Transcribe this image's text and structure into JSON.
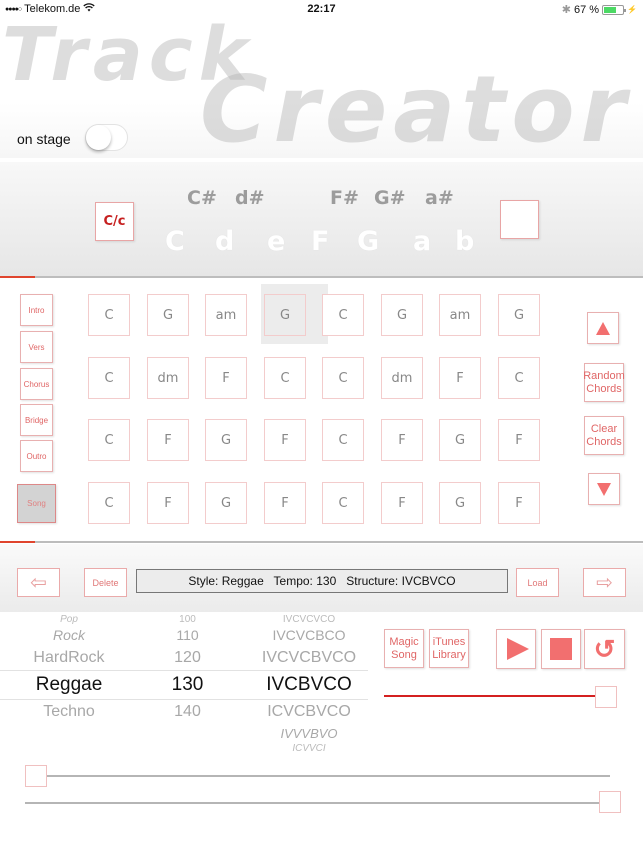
{
  "status_bar": {
    "signal": "●●●●○",
    "carrier": "Telekom.de",
    "wifi_icon": "wifi-icon",
    "time": "22:17",
    "bluetooth_icon": "bluetooth-icon",
    "battery_percent": "67 %",
    "battery_level": 0.67,
    "charging_icon": "⚡"
  },
  "header": {
    "logo_line1": "Track",
    "logo_line2": "Creator",
    "on_stage_label": "on stage",
    "on_stage_enabled": false
  },
  "key_selector": {
    "mode_button": "C/c",
    "sharp_keys": [
      "C#",
      "d#",
      "F#",
      "G#",
      "a#"
    ],
    "natural_keys": [
      "C",
      "d",
      "e",
      "F",
      "G",
      "a",
      "b"
    ],
    "progress": 0.055
  },
  "parts": [
    "Intro",
    "Vers",
    "Chorus",
    "Bridge",
    "Outro"
  ],
  "song_button": "Song",
  "chord_rows": [
    [
      "C",
      "G",
      "am",
      "G",
      "C",
      "G",
      "am",
      "G"
    ],
    [
      "C",
      "dm",
      "F",
      "C",
      "C",
      "dm",
      "F",
      "C"
    ],
    [
      "C",
      "F",
      "G",
      "F",
      "C",
      "F",
      "G",
      "F"
    ],
    [
      "C",
      "F",
      "G",
      "F",
      "C",
      "F",
      "G",
      "F"
    ]
  ],
  "selected_chord": {
    "row": 0,
    "col": 3
  },
  "side_buttons": {
    "up": "up-arrow",
    "random": "Random Chords",
    "clear": "Clear Chords",
    "down": "down-arrow"
  },
  "grid_progress": 0.055,
  "nav": {
    "prev_icon": "⇦",
    "delete": "Delete",
    "info": "Style: Reggae   Tempo: 130   Structure: IVCBVCO",
    "load": "Load",
    "next_icon": "⇨"
  },
  "picker": {
    "styles": [
      "Pop",
      "Rock",
      "HardRock",
      "Reggae",
      "Techno"
    ],
    "tempos": [
      "100",
      "110",
      "120",
      "130",
      "140"
    ],
    "structures": [
      "IVCVCVCO",
      "IVCVCBCO",
      "IVCVCBVCO",
      "IVCBVCO",
      "ICVCBVCO",
      "IVVVBVO",
      "ICVVCI"
    ],
    "selected_style": "Reggae",
    "selected_tempo": "130",
    "selected_structure": "IVCBVCO"
  },
  "transport": {
    "magic_song": "Magic Song",
    "itunes_library": "iTunes Library",
    "play": "play",
    "stop": "stop",
    "repeat": "↺",
    "volume": 1.0
  },
  "sliders": {
    "slider1": 0.0,
    "slider2": 1.0
  }
}
